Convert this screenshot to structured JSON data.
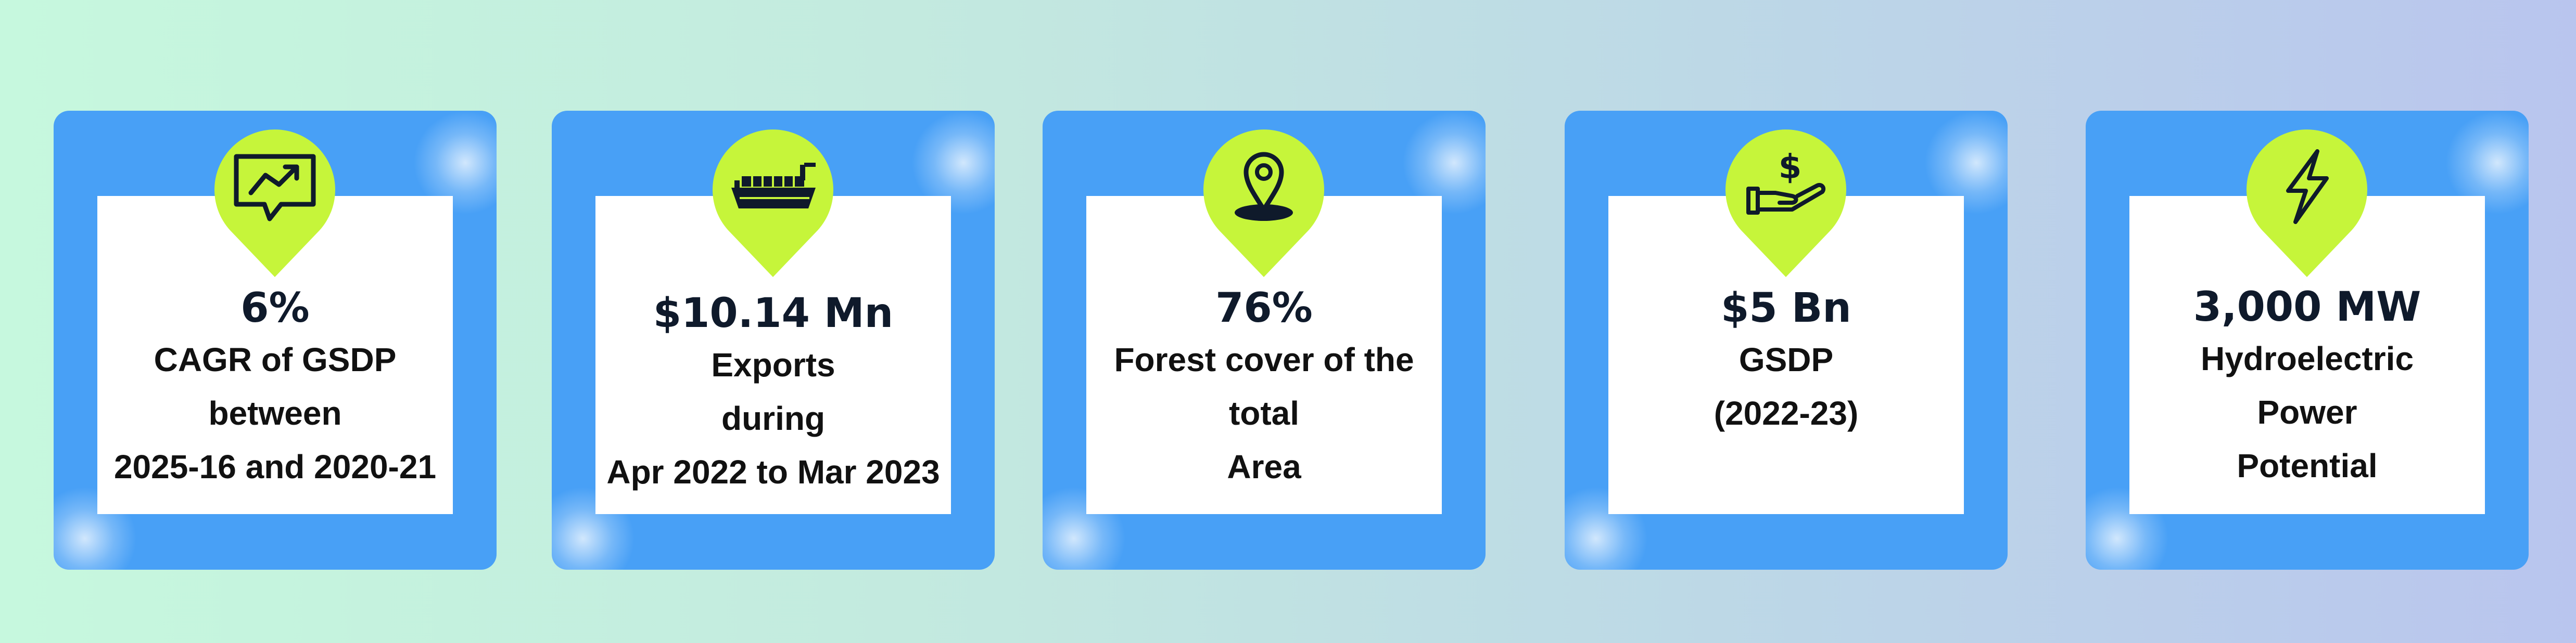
{
  "colors": {
    "card": "#48a0f6",
    "pin": "#c6f53a",
    "panel": "#ffffff",
    "text": "#111111"
  },
  "cards": [
    {
      "icon": "growth-chart-icon",
      "value": "6%",
      "lines": [
        "CAGR of GSDP",
        "between",
        "2025-16 and 2020-21"
      ]
    },
    {
      "icon": "cargo-ship-icon",
      "value": "$10.14 Mn",
      "lines": [
        "Exports",
        "during",
        "Apr 2022 to Mar 2023"
      ]
    },
    {
      "icon": "location-pin-icon",
      "value": "76%",
      "lines": [
        "Forest cover of the",
        "total",
        "Area"
      ]
    },
    {
      "icon": "money-hand-icon",
      "value": "$5 Bn",
      "lines": [
        "GSDP",
        "(2022-23)"
      ]
    },
    {
      "icon": "lightning-icon",
      "value": "3,000 MW",
      "lines": [
        "Hydroelectric",
        "Power",
        "Potential"
      ]
    }
  ]
}
